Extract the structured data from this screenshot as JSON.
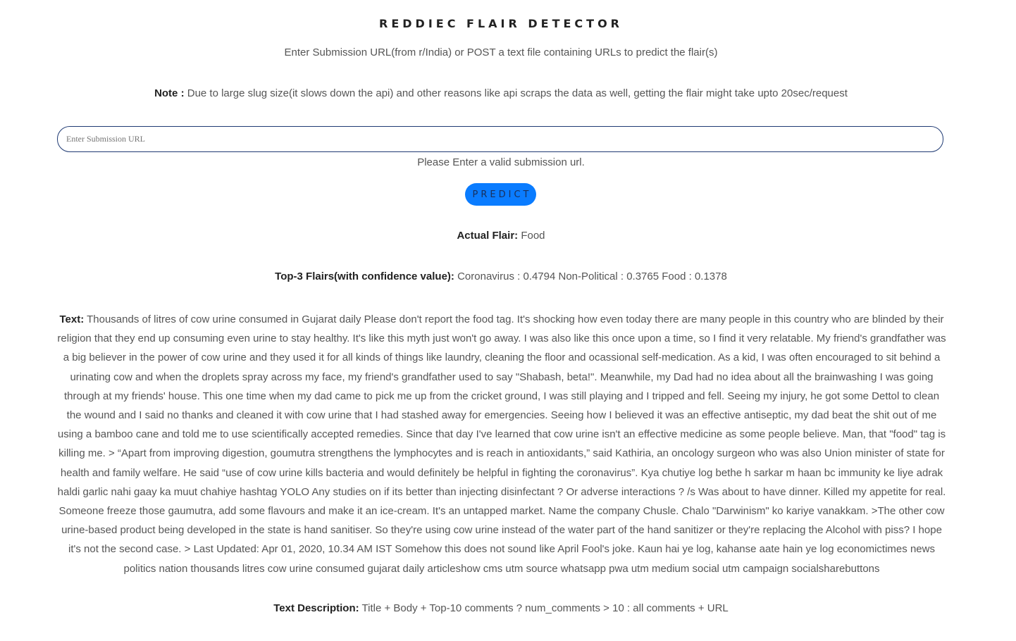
{
  "header": {
    "title": "REDDIEC FLAIR DETECTOR",
    "subtitle": "Enter Submission URL(from r/India) or POST a text file containing URLs to predict the flair(s)"
  },
  "note": {
    "label": "Note :",
    "text": " Due to large slug size(it slows down the api) and other reasons like api scraps the data as well, getting the flair might take upto 20sec/request"
  },
  "form": {
    "url_placeholder": "Enter Submission URL",
    "url_value": "",
    "validation_message": "Please Enter a valid submission url.",
    "predict_label": "PREDICT"
  },
  "results": {
    "actual_label": "Actual Flair:",
    "actual_value": " Food",
    "top3_label": "Top-3 Flairs(with confidence value):",
    "top3_value": " Coronavirus : 0.4794 Non-Political : 0.3765 Food : 0.1378",
    "text_label": "Text:",
    "text_value": " Thousands of litres of cow urine consumed in Gujarat daily Please don't report the food tag. It's shocking how even today there are many people in this country who are blinded by their religion that they end up consuming even urine to stay healthy. It's like this myth just won't go away. I was also like this once upon a time, so I find it very relatable. My friend's grandfather was a big believer in the power of cow urine and they used it for all kinds of things like laundry, cleaning the floor and ocassional self-medication. As a kid, I was often encouraged to sit behind a urinating cow and when the droplets spray across my face, my friend's grandfather used to say \"Shabash, beta!\". Meanwhile, my Dad had no idea about all the brainwashing I was going through at my friends' house. This one time when my dad came to pick me up from the cricket ground, I was still playing and I tripped and fell. Seeing my injury, he got some Dettol to clean the wound and I said no thanks and cleaned it with cow urine that I had stashed away for emergencies. Seeing how I believed it was an effective antiseptic, my dad beat the shit out of me using a bamboo cane and told me to use scientifically accepted remedies. Since that day I've learned that cow urine isn't an effective medicine as some people believe. Man, that \"food\" tag is killing me. > “Apart from improving digestion, goumutra strengthens the lymphocytes and is reach in antioxidants,” said Kathiria, an oncology surgeon who was also Union minister of state for health and family welfare. He said “use of cow urine kills bacteria and would definitely be helpful in fighting the coronavirus”. Kya chutiye log bethe h sarkar m haan bc immunity ke liye adrak haldi garlic nahi gaay ka muut chahiye hashtag YOLO Any studies on if its better than injecting disinfectant ? Or adverse interactions ? /s Was about to have dinner. Killed my appetite for real. Someone freeze those gaumutra, add some flavours and make it an ice-cream. It's an untapped market. Name the company Chusle. Chalo \"Darwinism\" ko kariye vanakkam. >The other cow urine-based product being developed in the state is hand sanitiser. So they're using cow urine instead of the water part of the hand sanitizer or they're replacing the Alcohol with piss? I hope it's not the second case. > Last Updated: Apr 01, 2020, 10.34 AM IST Somehow this does not sound like April Fool's joke. Kaun hai ye log, kahanse aate hain ye log economictimes news politics nation thousands litres cow urine consumed gujarat daily articleshow cms utm source whatsapp pwa utm medium social utm campaign socialsharebuttons",
    "desc_label": "Text Description:",
    "desc_value": " Title + Body + Top-10 comments ? num_comments > 10 : all comments + URL"
  },
  "colors": {
    "button_bg": "#0a7cff",
    "input_border": "#1f3a73",
    "label_text": "#222222",
    "body_text": "#555555"
  }
}
